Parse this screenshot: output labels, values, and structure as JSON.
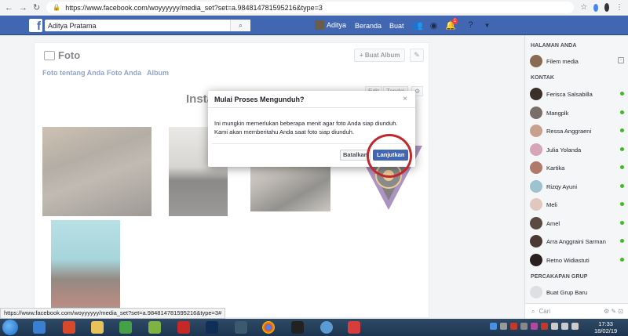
{
  "browser": {
    "url": "https://www.facebook.com/woyyyyyy/media_set?set=a.984814781595216&type=3",
    "status_url": "https://www.facebook.com/woyyyyyy/media_set?set=a.984814781595216&type=3#"
  },
  "fb_header": {
    "search_value": "Aditya Pratama",
    "user_name": "Aditya",
    "home_label": "Beranda",
    "create_label": "Buat",
    "notification_count": "1"
  },
  "photos_page": {
    "title": "Foto",
    "create_album_label": "+ Buat Album",
    "tabs": [
      "Foto tentang Anda",
      "Foto Anda",
      "Album"
    ],
    "album_heading": "Insta",
    "edit_label": "Edit",
    "tag_label": "Tandai"
  },
  "dialog": {
    "title": "Mulai Proses Mengunduh?",
    "body": "Ini mungkin memerlukan beberapa menit agar foto Anda siap diunduh. Kami akan memberitahu Anda saat foto siap diunduh.",
    "cancel_label": "Batalkan",
    "confirm_label": "Lanjutkan",
    "close_glyph": "×"
  },
  "sidebar": {
    "pages_heading": "HALAMAN ANDA",
    "page_name": "Filem media",
    "contacts_heading": "KONTAK",
    "contacts": [
      "Ferisca Salsabilla",
      "Mangplk",
      "Ressa Anggraeni",
      "Julia Yolanda",
      "Kartika",
      "Rizqy Ayuni",
      "Meli",
      "Amel",
      "Arra Anggraini Sarman",
      "Retno Widiastuti"
    ],
    "group_heading": "PERCAKAPAN GRUP",
    "new_group_label": "Buat Grup Baru",
    "search_placeholder": "Cari"
  },
  "taskbar": {
    "time": "17:33",
    "date": "18/02/19"
  },
  "colors": {
    "fb_blue": "#4267b2",
    "highlight_ring": "#c1272d",
    "online": "#42b72a"
  }
}
